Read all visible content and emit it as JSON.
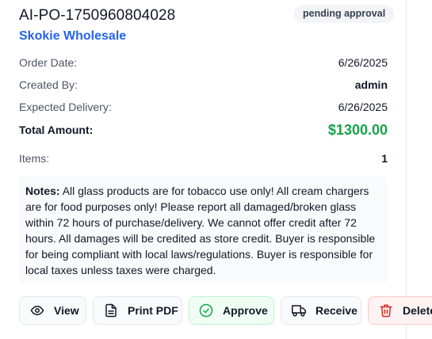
{
  "order": {
    "number": "AI-PO-1750960804028",
    "status": "pending approval",
    "vendor": "Skokie Wholesale"
  },
  "details": {
    "order_date_label": "Order Date:",
    "order_date": "6/26/2025",
    "created_by_label": "Created By:",
    "created_by": "admin",
    "expected_delivery_label": "Expected Delivery:",
    "expected_delivery": "6/26/2025",
    "total_label": "Total Amount:",
    "total": "$1300.00",
    "items_label": "Items:",
    "items": "1"
  },
  "notes": {
    "label": "Notes:",
    "text": "All glass products are for tobacco use only! All cream chargers are for food purposes only! Please report all damaged/broken glass within 72 hours of purchase/delivery. We cannot offer credit after 72 hours. All damages will be credited as store credit. Buyer is responsible for being compliant with local laws/regulations. Buyer is responsible for local taxes unless taxes were charged."
  },
  "actions": {
    "view": "View",
    "print_pdf": "Print PDF",
    "approve": "Approve",
    "receive": "Receive",
    "delete": "Delete"
  },
  "colors": {
    "vendor_link": "#2563eb",
    "total_green": "#16a34a",
    "approve_green": "#16a34a",
    "delete_red": "#dc2626"
  },
  "icons": {
    "view": "eye-icon",
    "print_pdf": "document-icon",
    "approve": "check-circle-icon",
    "receive": "truck-icon",
    "delete": "trash-icon"
  }
}
